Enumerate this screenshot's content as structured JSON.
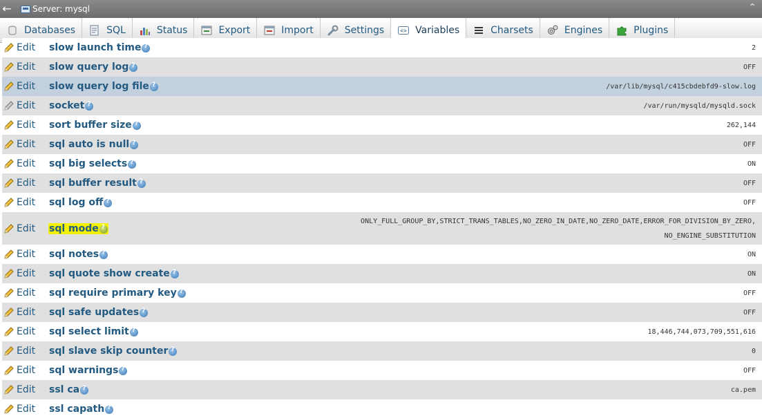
{
  "titlebar": {
    "title": "Server: mysql"
  },
  "tabs": [
    {
      "label": "Databases",
      "icon": "database-icon"
    },
    {
      "label": "SQL",
      "icon": "sql-icon"
    },
    {
      "label": "Status",
      "icon": "status-icon"
    },
    {
      "label": "Export",
      "icon": "export-icon"
    },
    {
      "label": "Import",
      "icon": "import-icon"
    },
    {
      "label": "Settings",
      "icon": "wrench-icon"
    },
    {
      "label": "Variables",
      "icon": "variables-icon"
    },
    {
      "label": "Charsets",
      "icon": "charsets-icon"
    },
    {
      "label": "Engines",
      "icon": "engines-icon"
    },
    {
      "label": "Plugins",
      "icon": "puzzle-icon"
    }
  ],
  "active_tab": "Variables",
  "edit_label": "Edit",
  "variables": [
    {
      "name": "slow launch time",
      "value": "2"
    },
    {
      "name": "slow query log",
      "value": "OFF"
    },
    {
      "name": "slow query log file",
      "value": "/var/lib/mysql/c415cbdebfd9-slow.log"
    },
    {
      "name": "socket",
      "value": "/var/run/mysqld/mysqld.sock"
    },
    {
      "name": "sort buffer size",
      "value": "262,144"
    },
    {
      "name": "sql auto is null",
      "value": "OFF"
    },
    {
      "name": "sql big selects",
      "value": "ON"
    },
    {
      "name": "sql buffer result",
      "value": "OFF"
    },
    {
      "name": "sql log off",
      "value": "OFF"
    },
    {
      "name": "sql mode",
      "value": "ONLY_FULL_GROUP_BY,STRICT_TRANS_TABLES,NO_ZERO_IN_DATE,NO_ZERO_DATE,ERROR_FOR_DIVISION_BY_ZERO,",
      "value2": "NO_ENGINE_SUBSTITUTION"
    },
    {
      "name": "sql notes",
      "value": "ON"
    },
    {
      "name": "sql quote show create",
      "value": "ON"
    },
    {
      "name": "sql require primary key",
      "value": "OFF"
    },
    {
      "name": "sql safe updates",
      "value": "OFF"
    },
    {
      "name": "sql select limit",
      "value": "18,446,744,073,709,551,616"
    },
    {
      "name": "sql slave skip counter",
      "value": "0"
    },
    {
      "name": "sql warnings",
      "value": "OFF"
    },
    {
      "name": "ssl ca",
      "value": "ca.pem"
    },
    {
      "name": "ssl capath",
      "value": ""
    }
  ],
  "colors": {
    "link": "#235a81",
    "row_alt": "#e0e0e0",
    "row_hover": "#c3d1de",
    "highlight": "#f2f200"
  }
}
